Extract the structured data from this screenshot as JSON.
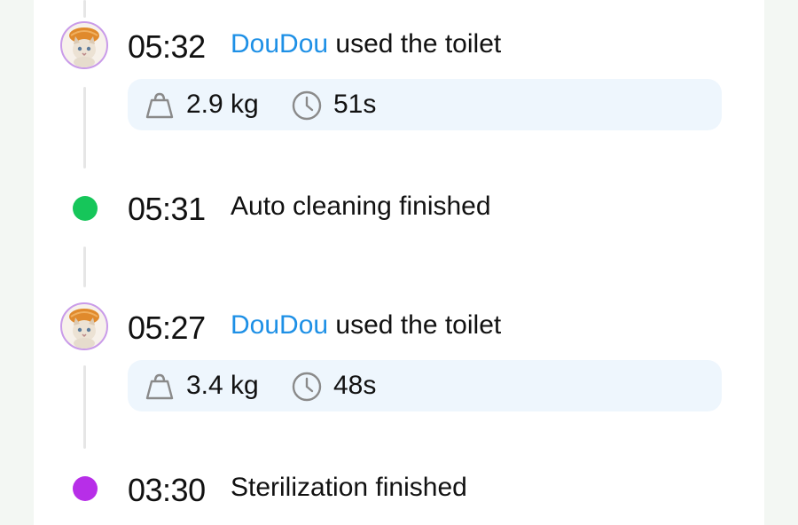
{
  "events": [
    {
      "type": "toilet",
      "time": "05:32",
      "cat_name": "DouDou",
      "action": "used the toilet",
      "weight": "2.9 kg",
      "duration": "51s",
      "avatar_icon": "cat-avatar-icon"
    },
    {
      "type": "status",
      "time": "05:31",
      "text": "Auto cleaning finished",
      "dot_color": "#16c65a"
    },
    {
      "type": "toilet",
      "time": "05:27",
      "cat_name": "DouDou",
      "action": "used the toilet",
      "weight": "3.4 kg",
      "duration": "48s",
      "avatar_icon": "cat-avatar-icon"
    },
    {
      "type": "status",
      "time": "03:30",
      "text": "Sterilization finished",
      "dot_color": "#b72ee8"
    }
  ],
  "colors": {
    "name_accent": "#1e90e6",
    "stats_bg": "#eef6fd",
    "timeline_line": "#e6e6e6",
    "avatar_border": "#c99be9"
  }
}
